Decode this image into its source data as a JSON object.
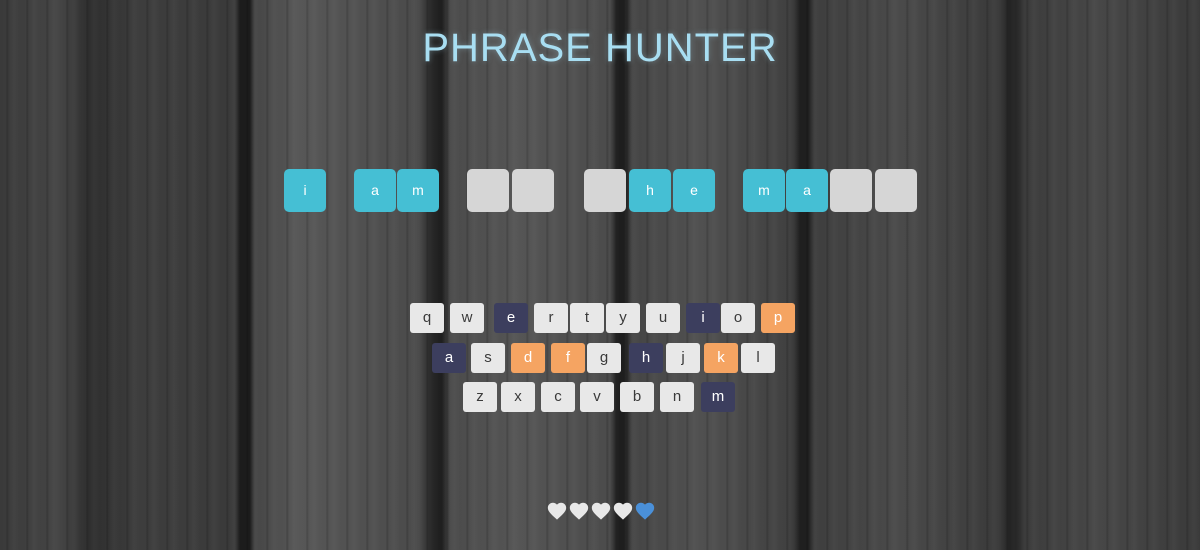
{
  "title": "PHRASE HUNTER",
  "phrase_tiles": [
    {
      "letter": "i",
      "shown": true
    },
    {
      "letter": "a",
      "shown": true
    },
    {
      "letter": "m",
      "shown": true
    },
    {
      "letter": "",
      "shown": false
    },
    {
      "letter": "",
      "shown": false
    },
    {
      "letter": "",
      "shown": false
    },
    {
      "letter": "h",
      "shown": true
    },
    {
      "letter": "e",
      "shown": true
    },
    {
      "letter": "m",
      "shown": true
    },
    {
      "letter": "a",
      "shown": true
    },
    {
      "letter": "",
      "shown": false
    },
    {
      "letter": "",
      "shown": false
    }
  ],
  "keyboard": [
    [
      {
        "key": "q",
        "state": "available"
      },
      {
        "key": "w",
        "state": "available"
      },
      {
        "key": "e",
        "state": "chosen"
      },
      {
        "key": "r",
        "state": "available"
      },
      {
        "key": "t",
        "state": "available"
      },
      {
        "key": "y",
        "state": "available"
      },
      {
        "key": "u",
        "state": "available"
      },
      {
        "key": "i",
        "state": "chosen"
      },
      {
        "key": "o",
        "state": "available"
      },
      {
        "key": "p",
        "state": "wrong"
      }
    ],
    [
      {
        "key": "a",
        "state": "chosen"
      },
      {
        "key": "s",
        "state": "available"
      },
      {
        "key": "d",
        "state": "wrong"
      },
      {
        "key": "f",
        "state": "wrong"
      },
      {
        "key": "g",
        "state": "available"
      },
      {
        "key": "h",
        "state": "chosen"
      },
      {
        "key": "j",
        "state": "available"
      },
      {
        "key": "k",
        "state": "wrong"
      },
      {
        "key": "l",
        "state": "available"
      }
    ],
    [
      {
        "key": "z",
        "state": "available"
      },
      {
        "key": "x",
        "state": "available"
      },
      {
        "key": "c",
        "state": "available"
      },
      {
        "key": "v",
        "state": "available"
      },
      {
        "key": "b",
        "state": "available"
      },
      {
        "key": "n",
        "state": "available"
      },
      {
        "key": "m",
        "state": "chosen"
      }
    ]
  ],
  "lives": {
    "remaining": 4,
    "lost": 1,
    "icon": "heart-icon"
  },
  "colors": {
    "title": "#a8def2",
    "tile_shown": "#45bfd4",
    "tile_hidden": "#d6d6d6",
    "key_available": "#e8e8e8",
    "key_wrong": "#f5a462",
    "key_chosen": "#3c3e5e",
    "heart_live": "#e8e8e8",
    "heart_lost": "#4a90d9"
  }
}
